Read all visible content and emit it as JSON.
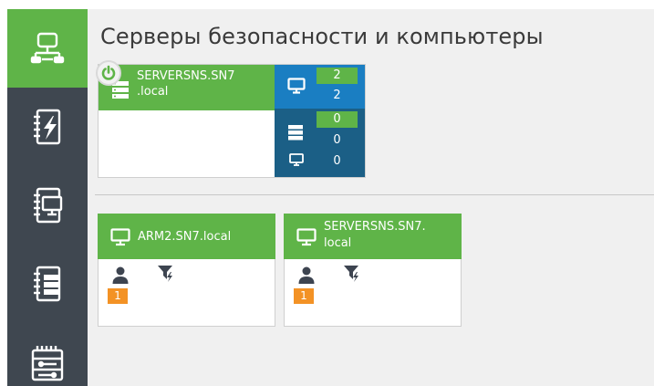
{
  "page": {
    "title": "Серверы безопасности и компьютеры"
  },
  "sidebar": {
    "items": [
      {
        "icon": "network-icon",
        "active": true
      },
      {
        "icon": "events-log-icon",
        "active": false
      },
      {
        "icon": "computers-book-icon",
        "active": false
      },
      {
        "icon": "servers-book-icon",
        "active": false
      },
      {
        "icon": "settings-book-icon",
        "active": false
      }
    ]
  },
  "server": {
    "name_line1": "SERVERSNS.SN7",
    "name_line2": ".local",
    "status_icon": "power-icon",
    "stats": {
      "computers_online": "2",
      "computers_total": "2",
      "servers_online": "0",
      "servers_total": "0",
      "other_total": "0"
    }
  },
  "computers": [
    {
      "name_line1": "ARM2.SN7.local",
      "name_line2": "",
      "users": "1"
    },
    {
      "name_line1": "SERVERSNS.SN7.",
      "name_line2": "local",
      "users": "1"
    }
  ],
  "colors": {
    "accent_green": "#5fb448",
    "sidebar_dark": "#3f4750",
    "stat_blue": "#1a7ec2",
    "stat_navy": "#1b5f86",
    "badge_orange": "#f39225"
  }
}
